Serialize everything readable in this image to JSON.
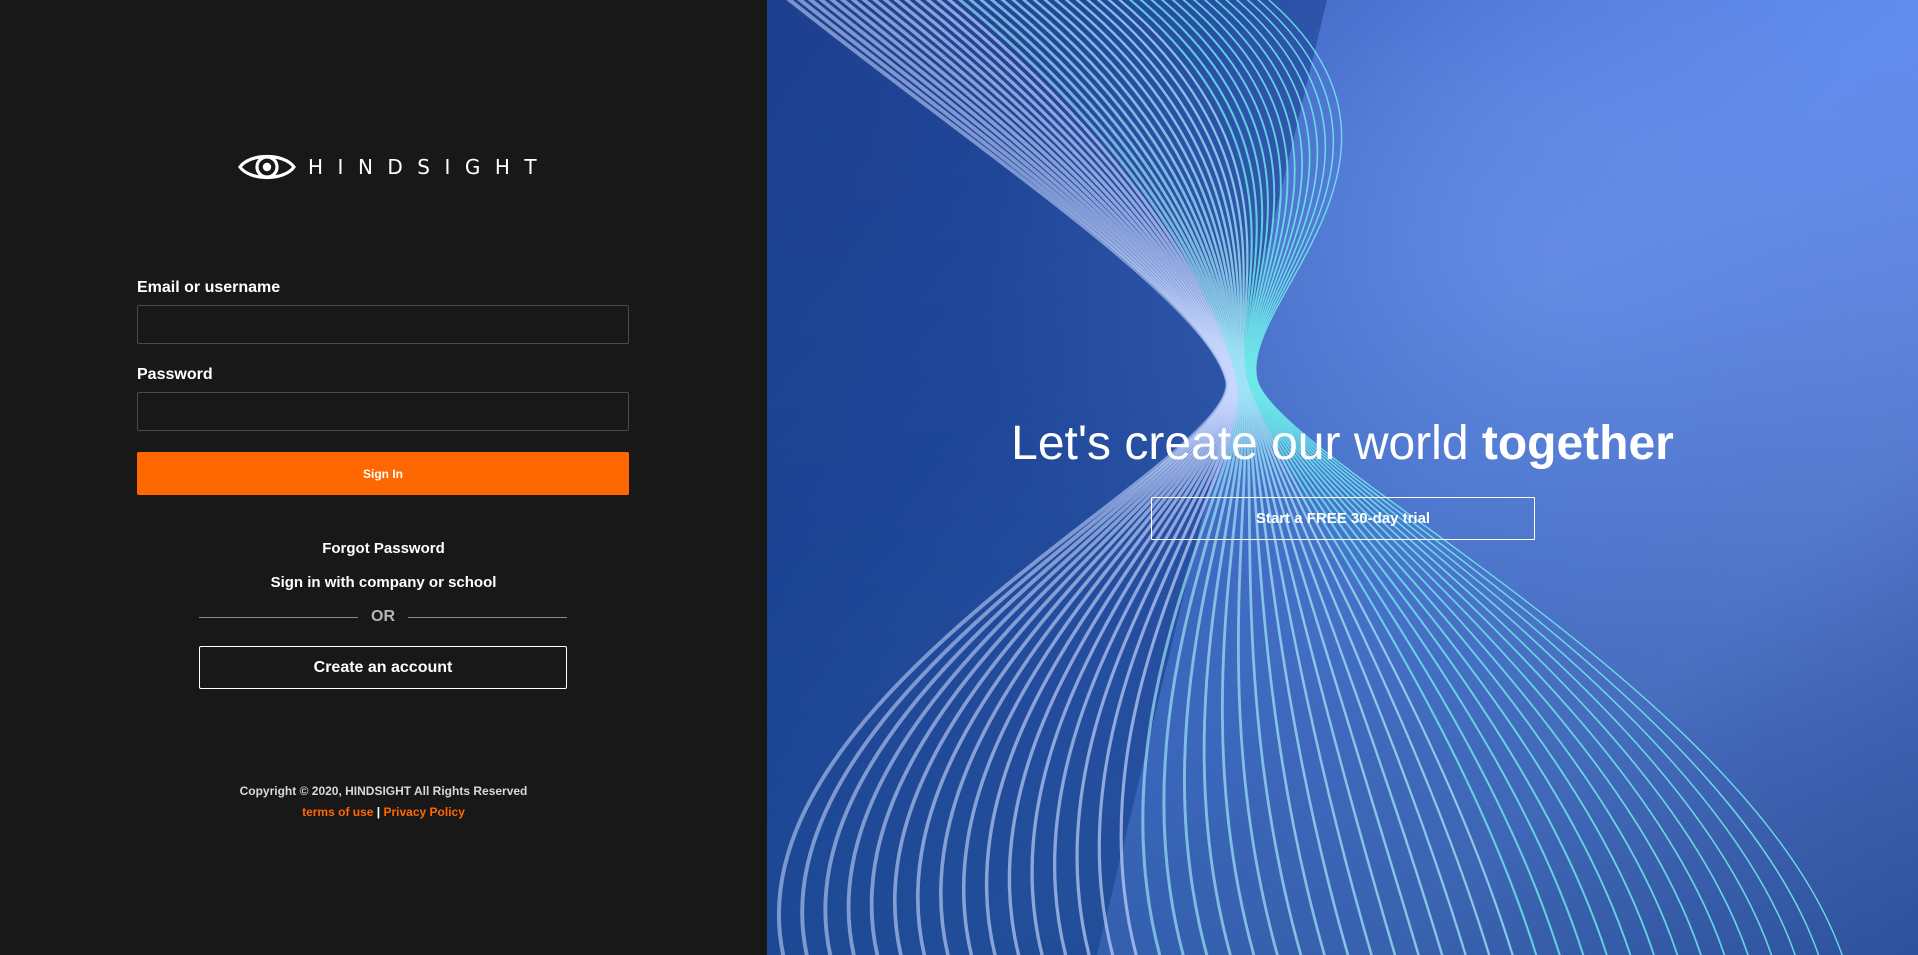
{
  "brand": {
    "name": "HINDSIGHT"
  },
  "login": {
    "email_label": "Email or username",
    "email_value": "",
    "password_label": "Password",
    "password_value": "",
    "signin_label": "Sign In",
    "forgot_label": "Forgot Password",
    "company_label": "Sign in with company or school",
    "or_label": "OR",
    "create_label": "Create an account"
  },
  "footer": {
    "copyright": "Copyright © 2020, HINDSIGHT All Rights Reserved",
    "terms_label": "terms of use",
    "separator": "|",
    "privacy_label": "Privacy Policy"
  },
  "hero": {
    "title_light": "Let's create our world ",
    "title_bold": "together",
    "trial_label": "Start a FREE 30-day trial"
  },
  "colors": {
    "left_background": "#181818",
    "accent_orange": "#ff6700",
    "hero_blue": "#5f8bef",
    "hero_teal_lines": "#5ee6e6"
  }
}
